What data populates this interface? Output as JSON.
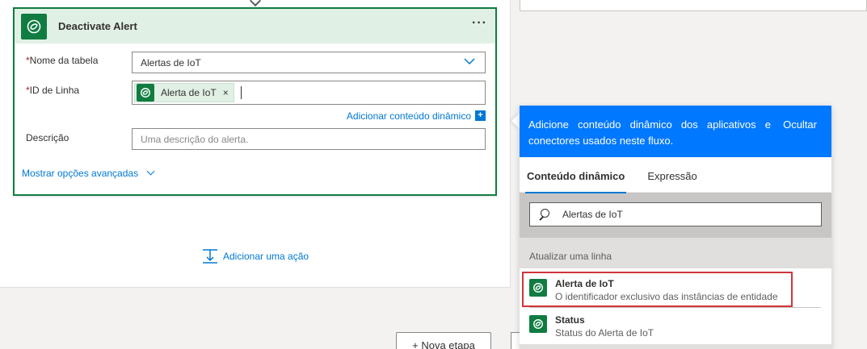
{
  "card": {
    "title": "Deactivate Alert",
    "menu": "···",
    "fields": {
      "table_name_label": "Nome da tabela",
      "table_name_value": "Alertas de IoT",
      "row_id_label": "ID de Linha",
      "row_id_token": "Alerta de IoT",
      "row_id_token_remove": "×",
      "description_label": "Descrição",
      "description_placeholder": "Uma descrição do alerta.",
      "required_marker": "*"
    },
    "add_dynamic_content": "Adicionar conteúdo dinâmico",
    "add_dynamic_plus": "+",
    "advanced_options": "Mostrar opções avançadas"
  },
  "add_action": "Adicionar uma ação",
  "new_step": "+ Nova etapa",
  "panel": {
    "header_message": "Adicione conteúdo dinâmico dos aplicativos e conectores usados neste fluxo.",
    "hide": "Ocultar",
    "tabs": [
      "Conteúdo dinâmico",
      "Expressão"
    ],
    "search_value": "Alertas de IoT",
    "section_title": "Atualizar uma linha",
    "items": [
      {
        "title": "Alerta de IoT",
        "description": "O identificador exclusivo das instâncias de entidade"
      },
      {
        "title": "Status",
        "description": "Status do Alerta de IoT"
      }
    ]
  },
  "colors": {
    "accent": "#0078d4",
    "connector_green": "#107c41",
    "panel_header_blue": "#0078ff",
    "highlight_red": "#d13438"
  },
  "icons": {
    "connector": "dataverse-icon",
    "search": "search-icon",
    "add_action": "add-action-icon",
    "dropdown": "chevron-down-icon"
  }
}
